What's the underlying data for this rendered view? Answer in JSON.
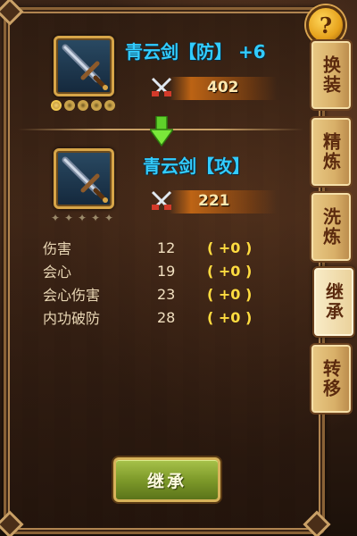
{
  "help": {
    "label": "?"
  },
  "tabs": [
    {
      "label": "换装",
      "active": false
    },
    {
      "label": "精炼",
      "active": false
    },
    {
      "label": "洗炼",
      "active": false
    },
    {
      "label": "继承",
      "active": true
    },
    {
      "label": "转移",
      "active": false
    }
  ],
  "source_item": {
    "name": "青云剑【防】",
    "enhance": "+6",
    "power": "402",
    "icon": "sword-icon",
    "stars_lit": 1,
    "stars_total": 5
  },
  "target_item": {
    "name": "青云剑【攻】",
    "power": "221",
    "icon": "sword-icon",
    "stars_lit": 0,
    "stars_total": 5
  },
  "stats": [
    {
      "label": "伤害",
      "value": "12",
      "bonus": "( +0 )"
    },
    {
      "label": "会心",
      "value": "19",
      "bonus": "( +0 )"
    },
    {
      "label": "会心伤害",
      "value": "23",
      "bonus": "( +0 )"
    },
    {
      "label": "内功破防",
      "value": "28",
      "bonus": "( +0 )"
    }
  ],
  "action_button": {
    "label": "继承"
  },
  "colors": {
    "item_name": "#33ccff",
    "bonus": "#ffdc40",
    "frame": "#8a6236",
    "button": "#7e9a2a"
  }
}
